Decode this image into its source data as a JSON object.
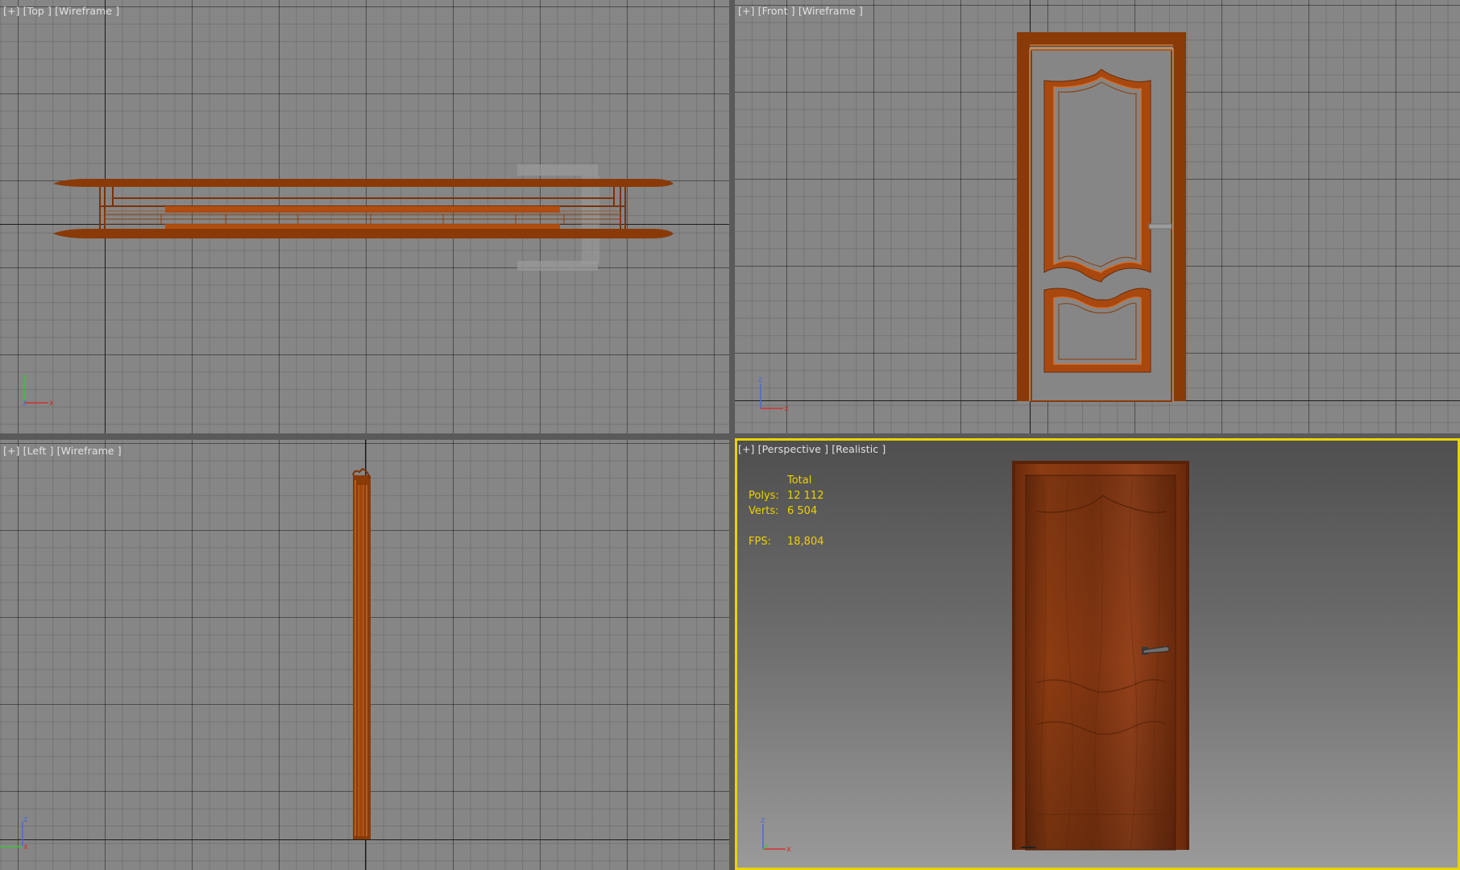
{
  "viewports": {
    "top": {
      "label": "[+] [Top ] [Wireframe ]",
      "gizmo": {
        "x": "x",
        "y": "y",
        "z": "z"
      }
    },
    "front": {
      "label": "[+] [Front ] [Wireframe ]",
      "gizmo": {
        "x": "x",
        "y": "y",
        "z": "z"
      }
    },
    "left": {
      "label": "[+] [Left ] [Wireframe ]",
      "gizmo": {
        "x": "x",
        "y": "y",
        "z": "z"
      }
    },
    "perspective": {
      "label": "[+] [Perspective ] [Realistic ]",
      "active": true,
      "stats": {
        "header": "Total",
        "polys_label": "Polys:",
        "polys_value": "12 112",
        "verts_label": "Verts:",
        "verts_value": "6 504",
        "fps_label": "FPS:",
        "fps_value": "18,804"
      },
      "gizmo": {
        "x": "x",
        "y": "y",
        "z": "z"
      }
    }
  },
  "colors": {
    "active_border": "#e8d400",
    "wire": "#8a3a06",
    "wire_fill": "#b04d10",
    "stats_text": "#f0d000",
    "label_text": "#e2e2e2",
    "door_wood": "#7a3510"
  }
}
